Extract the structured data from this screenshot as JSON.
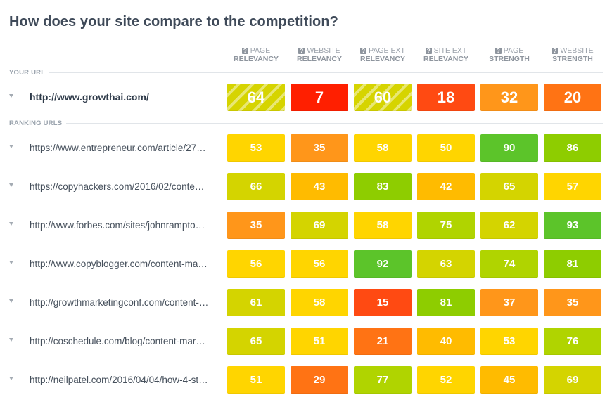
{
  "title": "How does your site compare to the competition?",
  "columns": [
    {
      "line1": "PAGE",
      "line2": "RELEVANCY",
      "help_icon": "question-icon"
    },
    {
      "line1": "WEBSITE",
      "line2": "RELEVANCY",
      "help_icon": "question-icon"
    },
    {
      "line1": "PAGE EXT",
      "line2": "RELEVANCY",
      "help_icon": "question-icon"
    },
    {
      "line1": "SITE EXT",
      "line2": "RELEVANCY",
      "help_icon": "question-icon"
    },
    {
      "line1": "PAGE",
      "line2": "STRENGTH",
      "help_icon": "question-icon"
    },
    {
      "line1": "WEBSITE",
      "line2": "STRENGTH",
      "help_icon": "question-icon"
    }
  ],
  "help_glyph": "?",
  "sections": {
    "your_url": "YOUR URL",
    "ranking_urls": "RANKING URLS"
  },
  "your_url": {
    "url": "http://www.growthai.com/",
    "scores": [
      {
        "value": "64",
        "color": "#d6d400",
        "striped": true
      },
      {
        "value": "7",
        "color": "#ff1f00",
        "striped": false
      },
      {
        "value": "60",
        "color": "#d6d400",
        "striped": true
      },
      {
        "value": "18",
        "color": "#ff4a12",
        "striped": false
      },
      {
        "value": "32",
        "color": "#ff961a",
        "striped": false
      },
      {
        "value": "20",
        "color": "#ff7314",
        "striped": false
      }
    ]
  },
  "ranking_urls": [
    {
      "url": "https://www.entrepreneur.com/article/27…",
      "scores": [
        {
          "value": "53",
          "color": "#ffd500"
        },
        {
          "value": "35",
          "color": "#ff961a"
        },
        {
          "value": "58",
          "color": "#ffd500"
        },
        {
          "value": "50",
          "color": "#ffd500"
        },
        {
          "value": "90",
          "color": "#5cc42a"
        },
        {
          "value": "86",
          "color": "#8ecd00"
        }
      ]
    },
    {
      "url": "https://copyhackers.com/2016/02/conte…",
      "scores": [
        {
          "value": "66",
          "color": "#d4d400"
        },
        {
          "value": "43",
          "color": "#ffbb00"
        },
        {
          "value": "83",
          "color": "#8ecd00"
        },
        {
          "value": "42",
          "color": "#ffbb00"
        },
        {
          "value": "65",
          "color": "#d4d400"
        },
        {
          "value": "57",
          "color": "#ffd500"
        }
      ]
    },
    {
      "url": "http://www.forbes.com/sites/johnrampto…",
      "scores": [
        {
          "value": "35",
          "color": "#ff961a"
        },
        {
          "value": "69",
          "color": "#d4d400"
        },
        {
          "value": "58",
          "color": "#ffd500"
        },
        {
          "value": "75",
          "color": "#b0d400"
        },
        {
          "value": "62",
          "color": "#d4d400"
        },
        {
          "value": "93",
          "color": "#5cc42a"
        }
      ]
    },
    {
      "url": "http://www.copyblogger.com/content-ma…",
      "scores": [
        {
          "value": "56",
          "color": "#ffd500"
        },
        {
          "value": "56",
          "color": "#ffd500"
        },
        {
          "value": "92",
          "color": "#5cc42a"
        },
        {
          "value": "63",
          "color": "#d4d400"
        },
        {
          "value": "74",
          "color": "#b0d400"
        },
        {
          "value": "81",
          "color": "#8ecd00"
        }
      ]
    },
    {
      "url": "http://growthmarketingconf.com/content-…",
      "scores": [
        {
          "value": "61",
          "color": "#d4d400"
        },
        {
          "value": "58",
          "color": "#ffd500"
        },
        {
          "value": "15",
          "color": "#ff4a12"
        },
        {
          "value": "81",
          "color": "#8ecd00"
        },
        {
          "value": "37",
          "color": "#ff961a"
        },
        {
          "value": "35",
          "color": "#ff961a"
        }
      ]
    },
    {
      "url": "http://coschedule.com/blog/content-mar…",
      "scores": [
        {
          "value": "65",
          "color": "#d4d400"
        },
        {
          "value": "51",
          "color": "#ffd500"
        },
        {
          "value": "21",
          "color": "#ff7314"
        },
        {
          "value": "40",
          "color": "#ffbb00"
        },
        {
          "value": "53",
          "color": "#ffd500"
        },
        {
          "value": "76",
          "color": "#b0d400"
        }
      ]
    },
    {
      "url": "http://neilpatel.com/2016/04/04/how-4-st…",
      "scores": [
        {
          "value": "51",
          "color": "#ffd500"
        },
        {
          "value": "29",
          "color": "#ff7314"
        },
        {
          "value": "77",
          "color": "#b0d400"
        },
        {
          "value": "52",
          "color": "#ffd500"
        },
        {
          "value": "45",
          "color": "#ffbb00"
        },
        {
          "value": "69",
          "color": "#d4d400"
        }
      ]
    }
  ]
}
